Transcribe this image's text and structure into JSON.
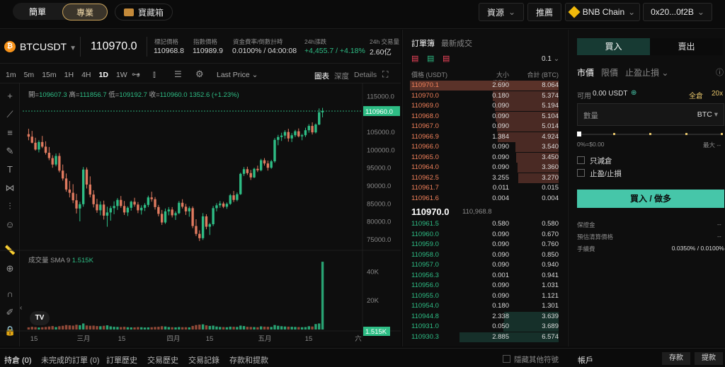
{
  "topbar": {
    "simple_label": "簡單",
    "pro_label": "專業",
    "treasure_label": "寶藏箱",
    "assets_label": "資源",
    "recommend_label": "推薦",
    "chain_label": "BNB Chain",
    "wallet_label": "0x20...0f2B"
  },
  "ticker": {
    "symbol": "BTCUSDT",
    "price": "110970.0",
    "mark_label": "標記價格",
    "mark_value": "110968.8",
    "index_label": "指數價格",
    "index_value": "110989.9",
    "funding_label": "資金費率/倒數計時",
    "funding_value": "0.0100% / 04:00:08",
    "change_label": "24h漲跌",
    "change_value": "+4,455.7 / +4.18%",
    "volume_label": "24h 交易量",
    "volume_value": "2.60亿"
  },
  "chart_toolbar": {
    "intervals": [
      "1m",
      "5m",
      "15m",
      "1H",
      "4H",
      "1D",
      "1W"
    ],
    "active_interval": "1D",
    "last_price_label": "Last Price",
    "chart_label": "圖表",
    "depth_label": "深度",
    "details_label": "Details"
  },
  "ohlc": {
    "open_label": "開=",
    "open": "109607.3",
    "high_label": "高=",
    "high": "111856.7",
    "low_label": "低=",
    "low": "109192.7",
    "close_label": "收=",
    "close": "110960.0",
    "change": "1352.6 (+1.23%)"
  },
  "volume_panel": {
    "label": "成交量",
    "sma_label": "SMA 9",
    "sma_value": "1.515K",
    "badge": "1.515K"
  },
  "chart_data": {
    "type": "candlestick",
    "price_axis": [
      "115000.0",
      "110960.0",
      "105000.0",
      "100000.0",
      "95000.0",
      "90000.0",
      "85000.0",
      "80000.0",
      "75000.0"
    ],
    "price_ticks": [
      115000,
      105000,
      100000,
      95000,
      90000,
      85000,
      80000,
      75000
    ],
    "price_ylim": [
      72000,
      117500
    ],
    "current_price": 110960.0,
    "volume_axis": [
      "40K",
      "20K"
    ],
    "volume_ticks": [
      40000,
      20000
    ],
    "x_labels": [
      "15",
      "三月",
      "15",
      "四月",
      "15",
      "五月",
      "15",
      "六"
    ],
    "candles": [
      [
        104500,
        106000,
        102800,
        103800
      ],
      [
        103800,
        105400,
        101900,
        102100
      ],
      [
        102100,
        103500,
        99900,
        100200
      ],
      [
        100200,
        102800,
        99400,
        102300
      ],
      [
        102300,
        104000,
        100600,
        101000
      ],
      [
        101000,
        102500,
        98800,
        99300
      ],
      [
        99300,
        100900,
        97200,
        97800
      ],
      [
        97800,
        98600,
        95100,
        96000
      ],
      [
        96000,
        99100,
        95500,
        98400
      ],
      [
        98400,
        99200,
        93800,
        94300
      ],
      [
        94300,
        96000,
        91500,
        92100
      ],
      [
        92100,
        93500,
        88400,
        89000
      ],
      [
        89000,
        91400,
        86800,
        88100
      ],
      [
        88100,
        90500,
        85200,
        86000
      ],
      [
        86000,
        87800,
        82300,
        83700
      ],
      [
        83700,
        85600,
        80100,
        84900
      ],
      [
        84900,
        95300,
        84200,
        94600
      ],
      [
        94600,
        95200,
        89300,
        90400
      ],
      [
        90400,
        92700,
        86800,
        87600
      ],
      [
        87600,
        88800,
        84000,
        84900
      ],
      [
        84900,
        86400,
        82500,
        83200
      ],
      [
        83200,
        85700,
        81800,
        84800
      ],
      [
        84800,
        85900,
        80600,
        81700
      ],
      [
        81700,
        84200,
        78600,
        82600
      ],
      [
        82600,
        84400,
        80300,
        83800
      ],
      [
        83800,
        85700,
        82100,
        84400
      ],
      [
        84400,
        86600,
        83300,
        86100
      ],
      [
        86100,
        87200,
        83900,
        84400
      ],
      [
        84400,
        85800,
        81900,
        82600
      ],
      [
        82600,
        84300,
        81600,
        83900
      ],
      [
        83900,
        85900,
        83100,
        85600
      ],
      [
        85600,
        86700,
        84200,
        84800
      ],
      [
        84800,
        85500,
        82400,
        83200
      ],
      [
        83200,
        84600,
        82000,
        83900
      ],
      [
        83900,
        85200,
        83000,
        84700
      ],
      [
        84700,
        87300,
        84100,
        86800
      ],
      [
        86800,
        88400,
        85600,
        86300
      ],
      [
        86300,
        86900,
        83400,
        84100
      ],
      [
        84100,
        84700,
        81500,
        82200
      ],
      [
        82200,
        83300,
        79100,
        79800
      ],
      [
        79800,
        83700,
        79400,
        82900
      ],
      [
        82900,
        84100,
        81800,
        83400
      ],
      [
        83400,
        84100,
        81200,
        81800
      ],
      [
        81800,
        82900,
        80500,
        82400
      ],
      [
        82400,
        85800,
        82100,
        85300
      ],
      [
        85300,
        86300,
        83700,
        84200
      ],
      [
        84200,
        85000,
        81900,
        82900
      ],
      [
        82900,
        84300,
        81400,
        83800
      ],
      [
        83800,
        84300,
        78200,
        78800
      ],
      [
        78800,
        80700,
        76000,
        76600
      ],
      [
        76600,
        77600,
        74600,
        75400
      ],
      [
        75400,
        82400,
        74900,
        81500
      ],
      [
        81500,
        82100,
        77900,
        78600
      ],
      [
        78600,
        79700,
        76300,
        79300
      ],
      [
        79300,
        84400,
        78800,
        83800
      ],
      [
        83800,
        85200,
        82900,
        84600
      ],
      [
        84600,
        85800,
        83900,
        85100
      ],
      [
        85100,
        85600,
        83800,
        84200
      ],
      [
        84200,
        85400,
        83600,
        85000
      ],
      [
        85000,
        87800,
        84700,
        87400
      ],
      [
        87400,
        88600,
        85500,
        86100
      ],
      [
        86100,
        88200,
        85700,
        87700
      ],
      [
        87700,
        93700,
        87500,
        93400
      ],
      [
        93400,
        95300,
        92800,
        94700
      ],
      [
        94700,
        95400,
        93100,
        93600
      ],
      [
        93600,
        94500,
        91700,
        92400
      ],
      [
        92400,
        95100,
        92200,
        94800
      ],
      [
        94800,
        95700,
        93900,
        94400
      ],
      [
        94400,
        97600,
        94100,
        97200
      ],
      [
        97200,
        97800,
        95700,
        96300
      ],
      [
        96300,
        97100,
        94300,
        95100
      ],
      [
        95100,
        97300,
        94800,
        96900
      ],
      [
        96900,
        103400,
        96500,
        102900
      ],
      [
        102900,
        104300,
        101400,
        103700
      ],
      [
        103700,
        104900,
        102600,
        104100
      ],
      [
        104100,
        105600,
        103200,
        105100
      ],
      [
        105100,
        106000,
        102400,
        103300
      ],
      [
        103300,
        104800,
        102300,
        104200
      ],
      [
        104200,
        105700,
        103700,
        105300
      ],
      [
        105300,
        106100,
        103600,
        103900
      ],
      [
        103900,
        104600,
        102800,
        104200
      ],
      [
        104200,
        106300,
        103700,
        105600
      ],
      [
        105600,
        107300,
        104900,
        106800
      ],
      [
        106800,
        107800,
        104400,
        105000
      ],
      [
        105000,
        107500,
        104700,
        107200
      ],
      [
        107200,
        111700,
        107000,
        110600
      ],
      [
        110600,
        111856,
        109192,
        110960
      ]
    ],
    "volumes": [
      1500,
      1900,
      1700,
      1400,
      1600,
      1800,
      2100,
      2400,
      1700,
      2300,
      2600,
      3100,
      2900,
      2700,
      3300,
      3000,
      4200,
      2800,
      2600,
      2700,
      2400,
      2300,
      2600,
      2900,
      2200,
      1900,
      1800,
      1700,
      1900,
      1600,
      1500,
      1500,
      1700,
      1600,
      1400,
      1500,
      1600,
      1800,
      1900,
      2300,
      2100,
      1700,
      1600,
      1500,
      1700,
      1600,
      1600,
      1500,
      2500,
      3100,
      3400,
      3600,
      2900,
      2500,
      2700,
      2100,
      1800,
      1700,
      1600,
      2000,
      1900,
      1800,
      2700,
      2400,
      1900,
      1800,
      1700,
      1600,
      2200,
      2000,
      1900,
      1800,
      3100,
      2600,
      2300,
      2100,
      2000,
      1900,
      1800,
      1700,
      1600,
      1700,
      2300,
      2100,
      3800,
      4200,
      47000,
      33000,
      1515
    ]
  },
  "orderbook": {
    "tab_book": "訂單簿",
    "tab_trades": "最新成交",
    "precision": "0.1",
    "col_price": "價格 (USDT)",
    "col_size": "大小 (BTC)",
    "col_total": "合計 (BTC)",
    "asks": [
      {
        "price": "110970.1",
        "size": "2.690",
        "total": "8.064",
        "depth": 1.0,
        "hl": true
      },
      {
        "price": "110970.0",
        "size": "0.180",
        "total": "5.374",
        "depth": 0.667
      },
      {
        "price": "110969.0",
        "size": "0.090",
        "total": "5.194",
        "depth": 0.644
      },
      {
        "price": "110968.0",
        "size": "0.090",
        "total": "5.104",
        "depth": 0.633
      },
      {
        "price": "110967.0",
        "size": "0.090",
        "total": "5.014",
        "depth": 0.622
      },
      {
        "price": "110966.9",
        "size": "1.384",
        "total": "4.924",
        "depth": 0.611
      },
      {
        "price": "110966.0",
        "size": "0.090",
        "total": "3.540",
        "depth": 0.439
      },
      {
        "price": "110965.0",
        "size": "0.090",
        "total": "3.450",
        "depth": 0.428
      },
      {
        "price": "110964.0",
        "size": "0.090",
        "total": "3.360",
        "depth": 0.417
      },
      {
        "price": "110962.5",
        "size": "3.255",
        "total": "3.270",
        "depth": 0.405
      },
      {
        "price": "110961.7",
        "size": "0.011",
        "total": "0.015",
        "depth": 0.0
      },
      {
        "price": "110961.6",
        "size": "0.004",
        "total": "0.004",
        "depth": 0.0
      }
    ],
    "mid_price": "110970.0",
    "mid_mark": "110,968.8",
    "bids": [
      {
        "price": "110961.5",
        "size": "0.580",
        "total": "0.580",
        "depth": 0.0
      },
      {
        "price": "110960.0",
        "size": "0.090",
        "total": "0.670",
        "depth": 0.0
      },
      {
        "price": "110959.0",
        "size": "0.090",
        "total": "0.760",
        "depth": 0.0
      },
      {
        "price": "110958.0",
        "size": "0.090",
        "total": "0.850",
        "depth": 0.0
      },
      {
        "price": "110957.0",
        "size": "0.090",
        "total": "0.940",
        "depth": 0.0
      },
      {
        "price": "110956.3",
        "size": "0.001",
        "total": "0.941",
        "depth": 0.0
      },
      {
        "price": "110956.0",
        "size": "0.090",
        "total": "1.031",
        "depth": 0.0
      },
      {
        "price": "110955.0",
        "size": "0.090",
        "total": "1.121",
        "depth": 0.0
      },
      {
        "price": "110954.0",
        "size": "0.180",
        "total": "1.301",
        "depth": 0.0
      },
      {
        "price": "110944.8",
        "size": "2.338",
        "total": "3.639",
        "depth": 0.55
      },
      {
        "price": "110931.0",
        "size": "0.050",
        "total": "3.689",
        "depth": 0.56
      },
      {
        "price": "110930.3",
        "size": "2.885",
        "total": "6.574",
        "depth": 1.0
      }
    ]
  },
  "trade": {
    "buy_tab": "買入",
    "sell_tab": "賣出",
    "market_label": "市價",
    "limit_label": "限價",
    "tpsl_label": "止盈止損",
    "available_label": "可用",
    "available_value": "0.00 USDT",
    "margin_mode": "全倉",
    "leverage": "20x",
    "qty_placeholder": "數量",
    "qty_unit": "BTC",
    "slider_left": "0%=$0.00",
    "slider_right_label": "最大",
    "slider_right_value": "--",
    "reduce_only": "只減倉",
    "tp_sl": "止盈/止損",
    "submit_label": "買入 / 做多",
    "margin_label": "保證金",
    "margin_value": "--",
    "liq_label": "預估清算價格",
    "liq_value": "--",
    "fee_label": "手續費",
    "fee_value": "0.0350% / 0.0100%"
  },
  "bottom": {
    "tabs": [
      "持倉 (0)",
      "未完成的訂單 (0)",
      "訂單歷史",
      "交易歷史",
      "交易記錄",
      "存款和提款"
    ],
    "hide_others": "隱藏其他符號",
    "account_label": "帳戶",
    "deposit_label": "存款",
    "withdraw_label": "提款"
  },
  "colors": {
    "up": "#2ebd85",
    "down": "#f6465d",
    "accent": "#46c6a9",
    "ask_bg": "#4a2a24",
    "bid_bg": "#16302a"
  }
}
